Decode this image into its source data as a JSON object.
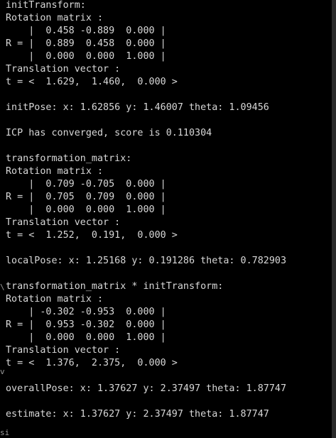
{
  "terminal": {
    "lines": [
      "initTransform:",
      "Rotation matrix :",
      "    |  0.458 -0.889  0.000 |",
      "R = |  0.889  0.458  0.000 |",
      "    |  0.000  0.000  1.000 |",
      "Translation vector :",
      "t = <  1.629,  1.460,  0.000 >",
      "",
      "initPose: x: 1.62856 y: 1.46007 theta: 1.09456",
      "",
      "ICP has converged, score is 0.110304",
      "",
      "transformation_matrix:",
      "Rotation matrix :",
      "    |  0.709 -0.705  0.000 |",
      "R = |  0.705  0.709  0.000 |",
      "    |  0.000  0.000  1.000 |",
      "Translation vector :",
      "t = <  1.252,  0.191,  0.000 >",
      "",
      "localPose: x: 1.25168 y: 0.191286 theta: 0.782903",
      "",
      "transformation_matrix * initTransform:",
      "Rotation matrix :",
      "    | -0.302 -0.953  0.000 |",
      "R = |  0.953 -0.302  0.000 |",
      "    |  0.000  0.000  1.000 |",
      "Translation vector :",
      "t = <  1.376,  2.375,  0.000 >",
      "",
      "overallPose: x: 1.37627 y: 2.37497 theta: 1.87747",
      "",
      "estimate: x: 1.37627 y: 2.37497 theta: 1.87747"
    ],
    "edge_glyphs": [
      "\\",
      "v",
      "si"
    ],
    "colors": {
      "background": "#000000",
      "text": "#d8d8d8"
    }
  }
}
